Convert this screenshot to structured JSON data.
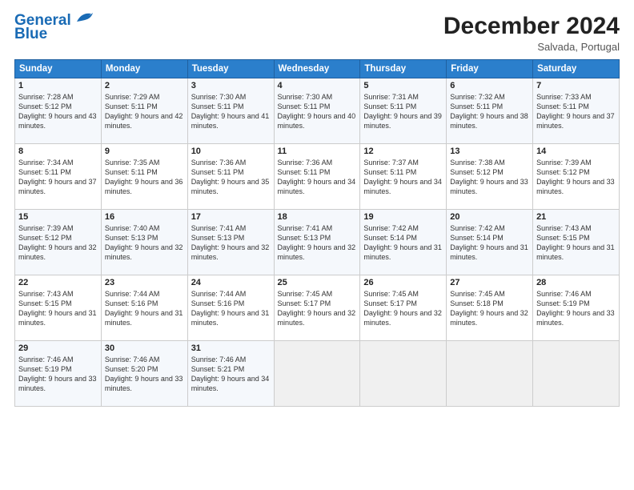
{
  "header": {
    "logo_line1": "General",
    "logo_line2": "Blue",
    "month": "December 2024",
    "location": "Salvada, Portugal"
  },
  "weekdays": [
    "Sunday",
    "Monday",
    "Tuesday",
    "Wednesday",
    "Thursday",
    "Friday",
    "Saturday"
  ],
  "weeks": [
    [
      {
        "day": "1",
        "sunrise": "7:28 AM",
        "sunset": "5:12 PM",
        "daylight": "9 hours and 43 minutes."
      },
      {
        "day": "2",
        "sunrise": "7:29 AM",
        "sunset": "5:11 PM",
        "daylight": "9 hours and 42 minutes."
      },
      {
        "day": "3",
        "sunrise": "7:30 AM",
        "sunset": "5:11 PM",
        "daylight": "9 hours and 41 minutes."
      },
      {
        "day": "4",
        "sunrise": "7:30 AM",
        "sunset": "5:11 PM",
        "daylight": "9 hours and 40 minutes."
      },
      {
        "day": "5",
        "sunrise": "7:31 AM",
        "sunset": "5:11 PM",
        "daylight": "9 hours and 39 minutes."
      },
      {
        "day": "6",
        "sunrise": "7:32 AM",
        "sunset": "5:11 PM",
        "daylight": "9 hours and 38 minutes."
      },
      {
        "day": "7",
        "sunrise": "7:33 AM",
        "sunset": "5:11 PM",
        "daylight": "9 hours and 37 minutes."
      }
    ],
    [
      {
        "day": "8",
        "sunrise": "7:34 AM",
        "sunset": "5:11 PM",
        "daylight": "9 hours and 37 minutes."
      },
      {
        "day": "9",
        "sunrise": "7:35 AM",
        "sunset": "5:11 PM",
        "daylight": "9 hours and 36 minutes."
      },
      {
        "day": "10",
        "sunrise": "7:36 AM",
        "sunset": "5:11 PM",
        "daylight": "9 hours and 35 minutes."
      },
      {
        "day": "11",
        "sunrise": "7:36 AM",
        "sunset": "5:11 PM",
        "daylight": "9 hours and 34 minutes."
      },
      {
        "day": "12",
        "sunrise": "7:37 AM",
        "sunset": "5:11 PM",
        "daylight": "9 hours and 34 minutes."
      },
      {
        "day": "13",
        "sunrise": "7:38 AM",
        "sunset": "5:12 PM",
        "daylight": "9 hours and 33 minutes."
      },
      {
        "day": "14",
        "sunrise": "7:39 AM",
        "sunset": "5:12 PM",
        "daylight": "9 hours and 33 minutes."
      }
    ],
    [
      {
        "day": "15",
        "sunrise": "7:39 AM",
        "sunset": "5:12 PM",
        "daylight": "9 hours and 32 minutes."
      },
      {
        "day": "16",
        "sunrise": "7:40 AM",
        "sunset": "5:13 PM",
        "daylight": "9 hours and 32 minutes."
      },
      {
        "day": "17",
        "sunrise": "7:41 AM",
        "sunset": "5:13 PM",
        "daylight": "9 hours and 32 minutes."
      },
      {
        "day": "18",
        "sunrise": "7:41 AM",
        "sunset": "5:13 PM",
        "daylight": "9 hours and 32 minutes."
      },
      {
        "day": "19",
        "sunrise": "7:42 AM",
        "sunset": "5:14 PM",
        "daylight": "9 hours and 31 minutes."
      },
      {
        "day": "20",
        "sunrise": "7:42 AM",
        "sunset": "5:14 PM",
        "daylight": "9 hours and 31 minutes."
      },
      {
        "day": "21",
        "sunrise": "7:43 AM",
        "sunset": "5:15 PM",
        "daylight": "9 hours and 31 minutes."
      }
    ],
    [
      {
        "day": "22",
        "sunrise": "7:43 AM",
        "sunset": "5:15 PM",
        "daylight": "9 hours and 31 minutes."
      },
      {
        "day": "23",
        "sunrise": "7:44 AM",
        "sunset": "5:16 PM",
        "daylight": "9 hours and 31 minutes."
      },
      {
        "day": "24",
        "sunrise": "7:44 AM",
        "sunset": "5:16 PM",
        "daylight": "9 hours and 31 minutes."
      },
      {
        "day": "25",
        "sunrise": "7:45 AM",
        "sunset": "5:17 PM",
        "daylight": "9 hours and 32 minutes."
      },
      {
        "day": "26",
        "sunrise": "7:45 AM",
        "sunset": "5:17 PM",
        "daylight": "9 hours and 32 minutes."
      },
      {
        "day": "27",
        "sunrise": "7:45 AM",
        "sunset": "5:18 PM",
        "daylight": "9 hours and 32 minutes."
      },
      {
        "day": "28",
        "sunrise": "7:46 AM",
        "sunset": "5:19 PM",
        "daylight": "9 hours and 33 minutes."
      }
    ],
    [
      {
        "day": "29",
        "sunrise": "7:46 AM",
        "sunset": "5:19 PM",
        "daylight": "9 hours and 33 minutes."
      },
      {
        "day": "30",
        "sunrise": "7:46 AM",
        "sunset": "5:20 PM",
        "daylight": "9 hours and 33 minutes."
      },
      {
        "day": "31",
        "sunrise": "7:46 AM",
        "sunset": "5:21 PM",
        "daylight": "9 hours and 34 minutes."
      },
      null,
      null,
      null,
      null
    ]
  ],
  "labels": {
    "sunrise": "Sunrise:",
    "sunset": "Sunset:",
    "daylight": "Daylight:"
  }
}
